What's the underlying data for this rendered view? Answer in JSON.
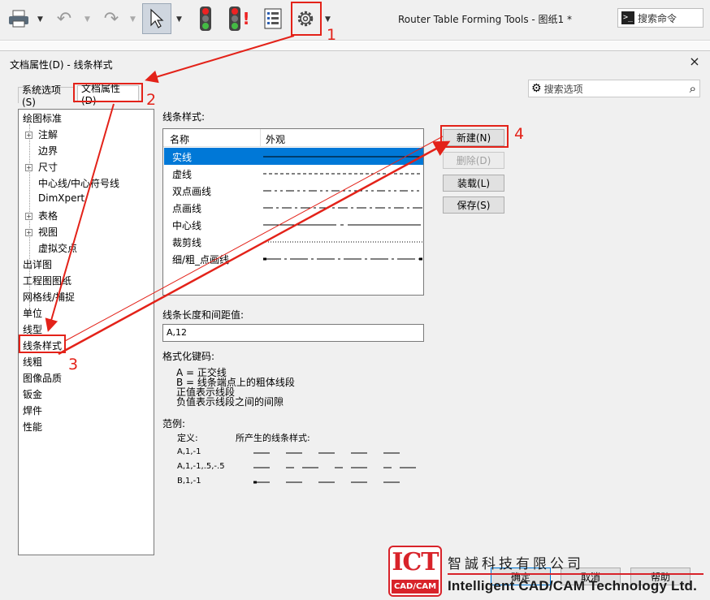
{
  "app_title": "Router Table Forming Tools - 图纸1 *",
  "search_command": {
    "placeholder": "搜索命令",
    "prompt_icon": ">_"
  },
  "dialog": {
    "title": "文档属性(D) - 线条样式",
    "close": "×",
    "tabs": [
      {
        "label": "系统选项(S)"
      },
      {
        "label": "文档属性(D)"
      }
    ],
    "search_options": "搜索选项",
    "tree": [
      {
        "label": "绘图标准"
      },
      {
        "label": "注解"
      },
      {
        "label": "边界"
      },
      {
        "label": "尺寸"
      },
      {
        "label": "中心线/中心符号线"
      },
      {
        "label": "DimXpert"
      },
      {
        "label": "表格"
      },
      {
        "label": "视图"
      },
      {
        "label": "虚拟交点"
      },
      {
        "label": "出详图"
      },
      {
        "label": "工程图图纸"
      },
      {
        "label": "网格线/捕捉"
      },
      {
        "label": "单位"
      },
      {
        "label": "线型"
      },
      {
        "label": "线条样式"
      },
      {
        "label": "线粗"
      },
      {
        "label": "图像品质"
      },
      {
        "label": "钣金"
      },
      {
        "label": "焊件"
      },
      {
        "label": "性能"
      }
    ],
    "line_styles_label": "线条样式:",
    "list_headers": {
      "name": "名称",
      "appearance": "外观"
    },
    "line_styles": [
      {
        "name": "实线",
        "selected": true
      },
      {
        "name": "虚线"
      },
      {
        "name": "双点画线"
      },
      {
        "name": "点画线"
      },
      {
        "name": "中心线"
      },
      {
        "name": "裁剪线"
      },
      {
        "name": "细/粗_点画线"
      }
    ],
    "buttons": {
      "new": "新建(N)",
      "delete": "删除(D)",
      "load": "装载(L)",
      "save": "保存(S)"
    },
    "length_label": "线条长度和间距值:",
    "length_value": "A,12",
    "format_label": "格式化键码:",
    "format_lines": [
      "A = 正交线",
      "B = 线条端点上的粗体线段",
      "正值表示线段",
      "负值表示线段之间的间隙"
    ],
    "example_label": "范例:",
    "example_def": "定义:",
    "example_result": "所产生的线条样式:",
    "examples": [
      "A,1,-1",
      "A,1,-1,.5,-.5",
      "B,1,-1"
    ],
    "bottom_buttons": {
      "ok": "确定",
      "cancel": "取消",
      "help": "帮助"
    }
  },
  "annotations": [
    "1",
    "2",
    "3",
    "4"
  ],
  "annotation_color": "#e32219",
  "selection_color": "#0078d7",
  "watermark": {
    "logo": "ICT",
    "logo_sub": "CAD/CAM",
    "chinese": "智誠科技有限公司",
    "english": "Intelligent CAD/CAM Technology Ltd."
  }
}
